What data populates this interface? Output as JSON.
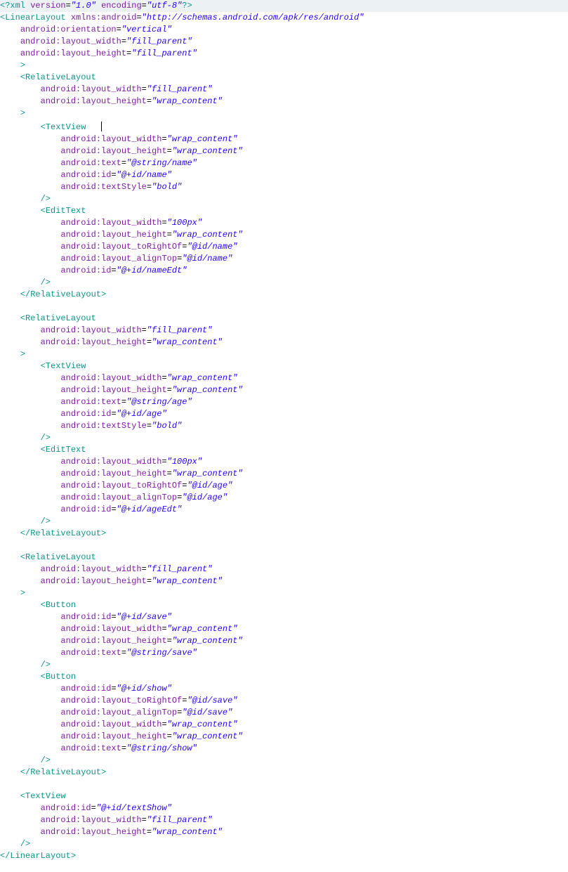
{
  "xml_decl": {
    "open": "<?",
    "xml": "xml",
    "ver_attr": "version",
    "ver_val": "\"1.0\"",
    "enc_attr": "encoding",
    "enc_val": "\"utf-8\"",
    "close": "?>"
  },
  "ll": {
    "tag": "LinearLayout",
    "xmlns_a": "xmlns:android",
    "xmlns_v": "\"http://schemas.android.com/apk/res/android\"",
    "orient_a": "android:orientation",
    "orient_v": "\"vertical\"",
    "lw_a": "android:layout_width",
    "lw_v": "\"fill_parent\"",
    "lh_a": "android:layout_height",
    "lh_v": "\"fill_parent\""
  },
  "rl1": {
    "tag": "RelativeLayout",
    "lw_a": "android:layout_width",
    "lw_v": "\"fill_parent\"",
    "lh_a": "android:layout_height",
    "lh_v": "\"wrap_content\""
  },
  "tv1": {
    "tag": "TextView",
    "lw_a": "android:layout_width",
    "lw_v": "\"wrap_content\"",
    "lh_a": "android:layout_height",
    "lh_v": "\"wrap_content\"",
    "text_a": "android:text",
    "text_v": "\"@string/name\"",
    "id_a": "android:id",
    "id_v": "\"@+id/name\"",
    "ts_a": "android:textStyle",
    "ts_v": "\"bold\""
  },
  "et1": {
    "tag": "EditText",
    "lw_a": "android:layout_width",
    "lw_v": "\"100px\"",
    "lh_a": "android:layout_height",
    "lh_v": "\"wrap_content\"",
    "ro_a": "android:layout_toRightOf",
    "ro_v": "\"@id/name\"",
    "at_a": "android:layout_alignTop",
    "at_v": "\"@id/name\"",
    "id_a": "android:id",
    "id_v": "\"@+id/nameEdt\""
  },
  "rl2": {
    "tag": "RelativeLayout",
    "lw_a": "android:layout_width",
    "lw_v": "\"fill_parent\"",
    "lh_a": "android:layout_height",
    "lh_v": "\"wrap_content\""
  },
  "tv2": {
    "tag": "TextView",
    "lw_a": "android:layout_width",
    "lw_v": "\"wrap_content\"",
    "lh_a": "android:layout_height",
    "lh_v": "\"wrap_content\"",
    "text_a": "android:text",
    "text_v": "\"@string/age\"",
    "id_a": "android:id",
    "id_v": "\"@+id/age\"",
    "ts_a": "android:textStyle",
    "ts_v": "\"bold\""
  },
  "et2": {
    "tag": "EditText",
    "lw_a": "android:layout_width",
    "lw_v": "\"100px\"",
    "lh_a": "android:layout_height",
    "lh_v": "\"wrap_content\"",
    "ro_a": "android:layout_toRightOf",
    "ro_v": "\"@id/age\"",
    "at_a": "android:layout_alignTop",
    "at_v": "\"@id/age\"",
    "id_a": "android:id",
    "id_v": "\"@+id/ageEdt\""
  },
  "rl3": {
    "tag": "RelativeLayout",
    "lw_a": "android:layout_width",
    "lw_v": "\"fill_parent\"",
    "lh_a": "android:layout_height",
    "lh_v": "\"wrap_content\""
  },
  "bt1": {
    "tag": "Button",
    "id_a": "android:id",
    "id_v": "\"@+id/save\"",
    "lw_a": "android:layout_width",
    "lw_v": "\"wrap_content\"",
    "lh_a": "android:layout_height",
    "lh_v": "\"wrap_content\"",
    "text_a": "android:text",
    "text_v": "\"@string/save\""
  },
  "bt2": {
    "tag": "Button",
    "id_a": "android:id",
    "id_v": "\"@+id/show\"",
    "ro_a": "android:layout_toRightOf",
    "ro_v": "\"@id/save\"",
    "at_a": "android:layout_alignTop",
    "at_v": "\"@id/save\"",
    "lw_a": "android:layout_width",
    "lw_v": "\"wrap_content\"",
    "lh_a": "android:layout_height",
    "lh_v": "\"wrap_content\"",
    "text_a": "android:text",
    "text_v": "\"@string/show\""
  },
  "tv3": {
    "tag": "TextView",
    "id_a": "android:id",
    "id_v": "\"@+id/textShow\"",
    "lw_a": "android:layout_width",
    "lw_v": "\"fill_parent\"",
    "lh_a": "android:layout_height",
    "lh_v": "\"wrap_content\""
  },
  "close_ll": "</LinearLayout>",
  "close_rl": "</RelativeLayout>"
}
